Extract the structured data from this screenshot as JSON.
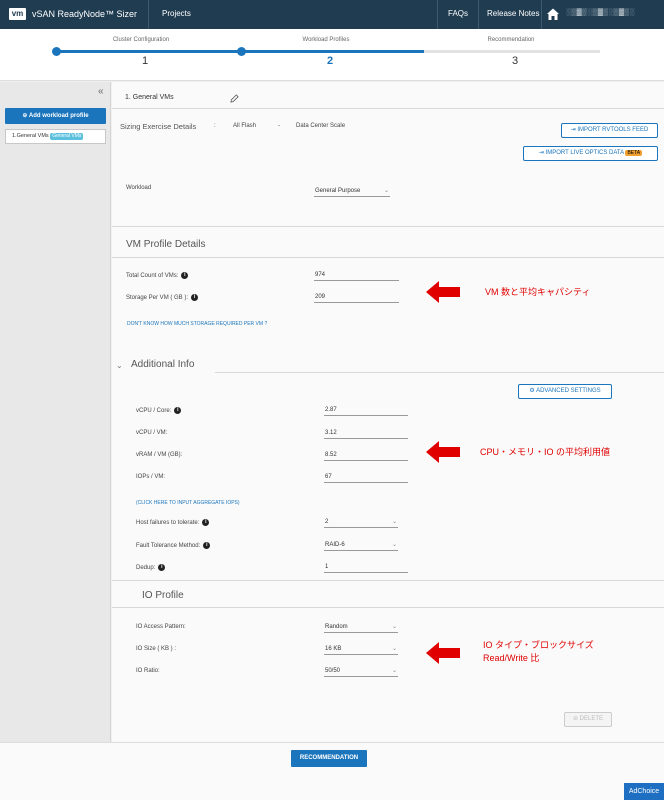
{
  "topbar": {
    "logo": "vm",
    "app_title": "vSAN ReadyNode™ Sizer",
    "nav": [
      "Projects",
      "FAQs",
      "Release Notes"
    ],
    "user_text": "░▒▓▒░▒▓▒░▒▓▒░"
  },
  "stepper": {
    "steps": [
      {
        "label": "Cluster Configuration",
        "number": "1"
      },
      {
        "label": "Workload Profiles",
        "number": "2"
      },
      {
        "label": "Recommendation",
        "number": "3"
      }
    ],
    "active_step": 2
  },
  "sidebar": {
    "collapse": "«",
    "add_button": "Add workload profile",
    "profile_item": "1.General VMs",
    "profile_badge": "General VMs"
  },
  "profile_header": {
    "title": "1.  General VMs"
  },
  "sizing": {
    "label": "Sizing Exercise Details",
    "colon": ":",
    "flash": "All Flash",
    "dash": "-",
    "scale": "Data Center Scale",
    "import_rvtools": "IMPORT RVTOOLS FEED",
    "import_liveoptics": "IMPORT LIVE OPTICS DATA",
    "beta": "BETA",
    "workload_label": "Workload",
    "workload_value": "General Purpose"
  },
  "vm_profile": {
    "title": "VM Profile Details",
    "total_label": "Total Count of VMs:",
    "total_value": "974",
    "storage_label": "Storage Per VM ( GB ):",
    "storage_value": "209",
    "help_link": "DON'T KNOW HOW MUCH STORAGE REQUIRED PER VM ?"
  },
  "additional": {
    "title": "Additional Info",
    "advanced_button": "ADVANCED SETTINGS",
    "fields": [
      {
        "label": "vCPU / Core:",
        "value": "2.87",
        "info": true
      },
      {
        "label": "vCPU / VM:",
        "value": "3.12",
        "info": false
      },
      {
        "label": "vRAM / VM (GB):",
        "value": "8.52",
        "info": false
      },
      {
        "label": "IOPs / VM:",
        "value": "67",
        "info": false
      }
    ],
    "aggregate_link": "(CLICK HERE TO INPUT AGGREGATE IOPS)",
    "host_failures_label": "Host failures to tolerate:",
    "host_failures_value": "2",
    "ft_method_label": "Fault Tolerance Method:",
    "ft_method_value": "RAID-6",
    "dedup_label": "Dedup:",
    "dedup_value": "1"
  },
  "io_profile": {
    "title": "IO Profile",
    "pattern_label": "IO Access Pattern:",
    "pattern_value": "Random",
    "size_label": "IO Size ( KB ) :",
    "size_value": "16 KB",
    "ratio_label": "IO Ratio:",
    "ratio_value": "50/50"
  },
  "delete_button": "DELETE",
  "annotations": {
    "vm": "VM 数と平均キャパシティ",
    "cpu": "CPU・メモリ・IO の平均利用値",
    "io_line1": "IO タイプ・ブロックサイズ",
    "io_line2": "Read/Write 比"
  },
  "footer": {
    "recommendation": "RECOMMENDATION",
    "adchoice": "AdChoice"
  },
  "colors": {
    "topbar": "#1f3c51",
    "accent": "#1b75bc",
    "annotation": "#e00000"
  }
}
